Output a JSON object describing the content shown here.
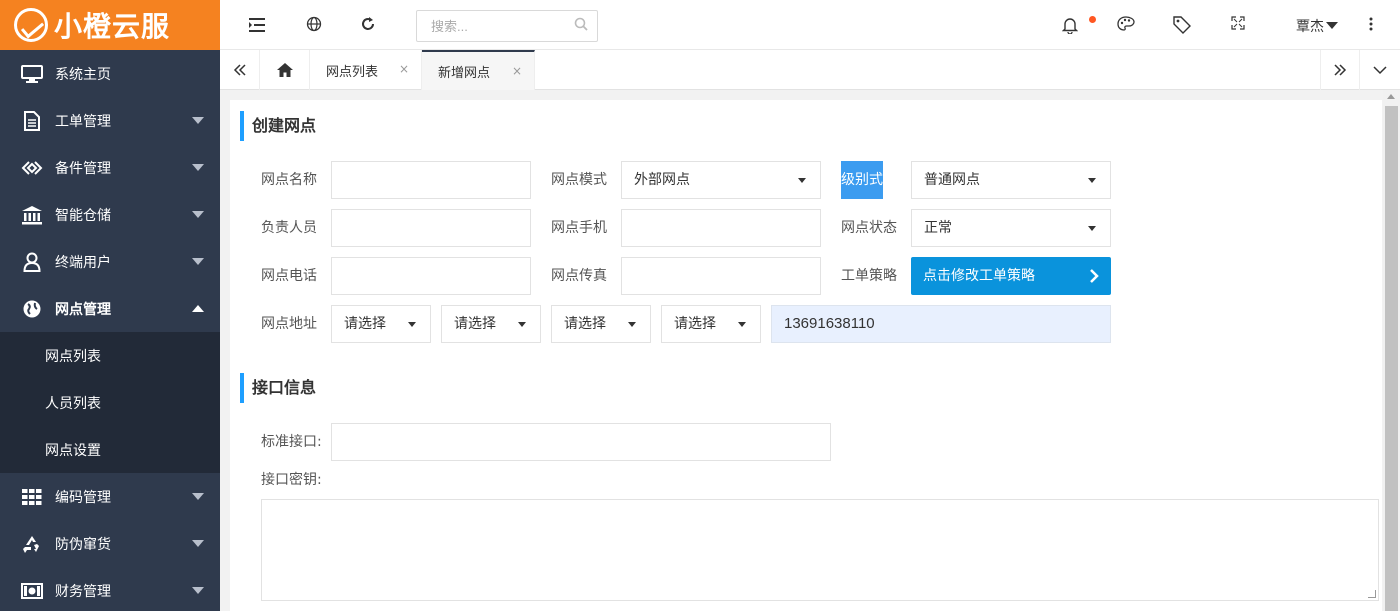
{
  "brand": {
    "name": "小橙云服",
    "color": "#f58220"
  },
  "sidebar": {
    "items": [
      {
        "label": "系统主页",
        "icon": "monitor-icon"
      },
      {
        "label": "工单管理",
        "icon": "document-icon"
      },
      {
        "label": "备件管理",
        "icon": "diamond-icon"
      },
      {
        "label": "智能仓储",
        "icon": "bank-icon"
      },
      {
        "label": "终端用户",
        "icon": "user-icon"
      },
      {
        "label": "网点管理",
        "icon": "globe-icon"
      }
    ],
    "sub_items": [
      {
        "label": "网点列表"
      },
      {
        "label": "人员列表"
      },
      {
        "label": "网点设置"
      }
    ],
    "items_after": [
      {
        "label": "编码管理",
        "icon": "grid-icon"
      },
      {
        "label": "防伪窜货",
        "icon": "recycle-icon"
      },
      {
        "label": "财务管理",
        "icon": "money-icon"
      }
    ]
  },
  "topbar": {
    "search_placeholder": "搜索...",
    "user_name": "覃杰",
    "icons": [
      "menu-toggle-icon",
      "globe-icon",
      "refresh-icon",
      "search-icon",
      "bell-icon",
      "palette-icon",
      "tag-icon",
      "fullscreen-icon",
      "more-vertical-icon"
    ]
  },
  "tabs": {
    "items": [
      {
        "label": "网点列表",
        "close": "×"
      },
      {
        "label": "新增网点",
        "close": "×"
      }
    ]
  },
  "form": {
    "section1_title": "创建网点",
    "name_label": "网点名称",
    "mode_label": "网点模式",
    "mode_value": "外部网点",
    "level_label": "级别式",
    "level_value": "普通网点",
    "owner_label": "负责人员",
    "mobile_label": "网点手机",
    "status_label": "网点状态",
    "status_value": "正常",
    "phone_label": "网点电话",
    "fax_label": "网点传真",
    "policy_label": "工单策略",
    "policy_button": "点击修改工单策略",
    "address_label": "网点地址",
    "address_selects": [
      "请选择",
      "请选择",
      "请选择",
      "请选择"
    ],
    "address_value": "13691638110"
  },
  "api": {
    "section_title": "接口信息",
    "standard_label": "标准接口:",
    "secret_label": "接口密钥:"
  }
}
